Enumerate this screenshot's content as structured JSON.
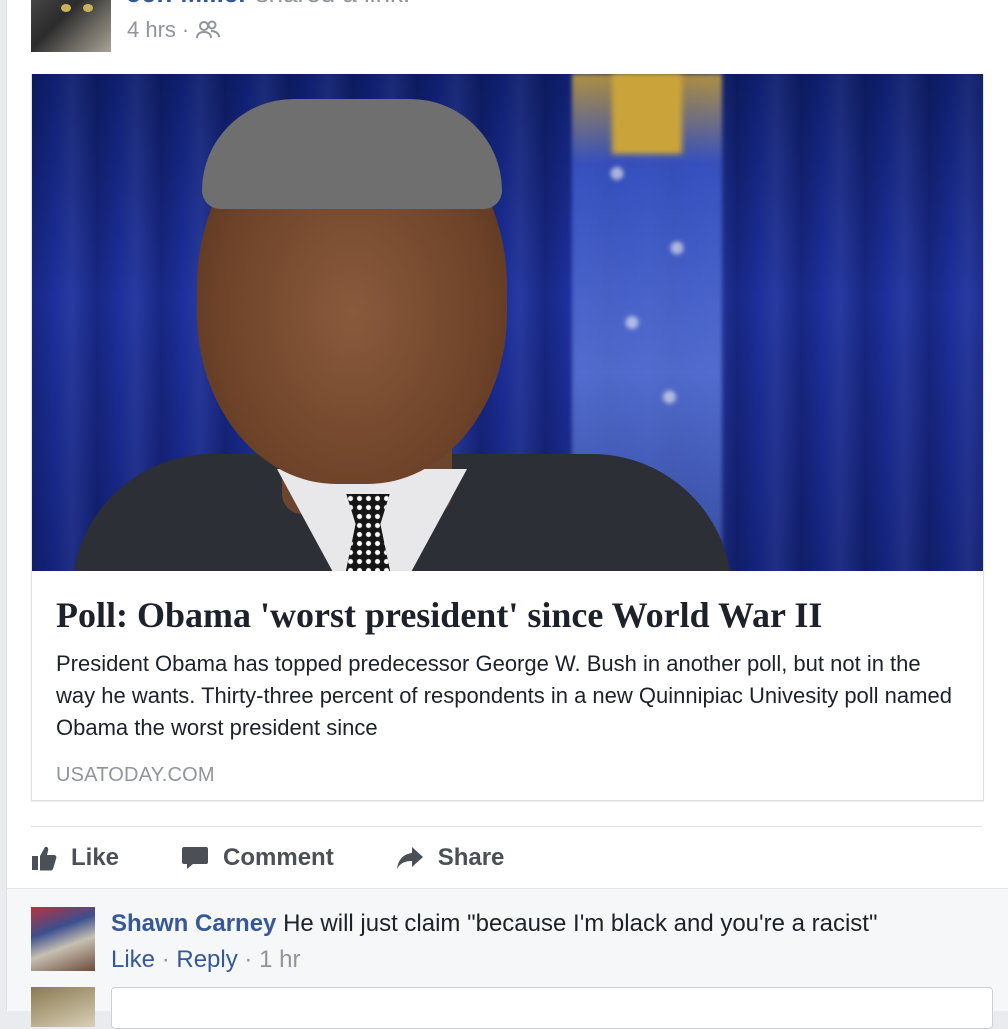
{
  "post": {
    "author": "Jeff Miller",
    "action": "shared a link.",
    "time": "4 hrs",
    "separator": "·",
    "audience_icon": "friends-icon"
  },
  "link": {
    "headline": "Poll: Obama 'worst president' since World War II",
    "description": "President Obama has topped predecessor George W. Bush in another poll, but not in the way he wants. Thirty-three percent of respondents in a new Quinnipiac Univesity poll named Obama the worst president since",
    "source": "USATODAY.COM"
  },
  "actions": [
    {
      "label": "Like",
      "icon": "thumbs-up-icon"
    },
    {
      "label": "Comment",
      "icon": "comment-bubble-icon"
    },
    {
      "label": "Share",
      "icon": "share-arrow-icon"
    }
  ],
  "comments": [
    {
      "author": "Shawn Carney",
      "text": "He will just claim \"because I'm black and you're a racist\"",
      "like_label": "Like",
      "reply_label": "Reply",
      "separator": "·",
      "time": "1 hr"
    }
  ],
  "colors": {
    "link_blue": "#365899",
    "meta_gray": "#90949c",
    "action_gray": "#4b4f56",
    "border": "#dddfe2"
  }
}
